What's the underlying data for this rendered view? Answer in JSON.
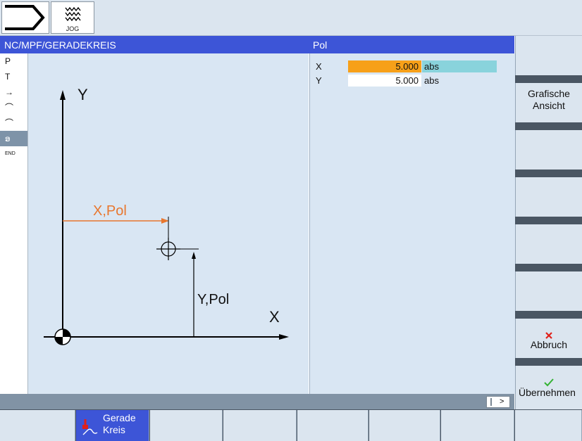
{
  "header": {
    "mode_icon": "arrow-tab-icon",
    "jog_label": "JOG",
    "jog_icon": "wave-icon"
  },
  "titlebar": {
    "left": "NC/MPF/GERADEKREIS",
    "right": "Pol"
  },
  "left_strip": {
    "items": [
      "P",
      "T",
      "→",
      "⌒",
      "⌒",
      "ອ",
      "END"
    ],
    "selected_index": 5
  },
  "graphic": {
    "y_axis": "Y",
    "x_axis": "X",
    "x_pol": "X,Pol",
    "y_pol": "Y,Pol"
  },
  "params": [
    {
      "label": "X",
      "value": "5.000",
      "unit": "abs",
      "active": true
    },
    {
      "label": "Y",
      "value": "5.000",
      "unit": "abs",
      "active": false
    }
  ],
  "status": {
    "scroll_label": ">"
  },
  "vertical_softkeys": [
    {
      "label": ""
    },
    {
      "label": "Grafische\nAnsicht"
    },
    {
      "label": ""
    },
    {
      "label": ""
    },
    {
      "label": ""
    },
    {
      "label": ""
    },
    {
      "label": "Abbruch",
      "icon": "cross-icon"
    },
    {
      "label": "Übernehmen",
      "icon": "checkmark-icon"
    }
  ],
  "horizontal_softkeys": [
    {
      "label": ""
    },
    {
      "label": "Gerade\nKreis",
      "icon": "line-circle-icon",
      "active": true
    },
    {
      "label": ""
    },
    {
      "label": ""
    },
    {
      "label": ""
    },
    {
      "label": ""
    },
    {
      "label": ""
    },
    {
      "label": ""
    }
  ],
  "colors": {
    "title_bar": "#3d55d7",
    "panel_bg": "#d9e6f3",
    "active_field": "#f7a019",
    "unit_highlight": "#89d3dc",
    "x_pol": "#e8772e",
    "abort_cross": "#e0201a",
    "accept_check": "#34b233"
  }
}
